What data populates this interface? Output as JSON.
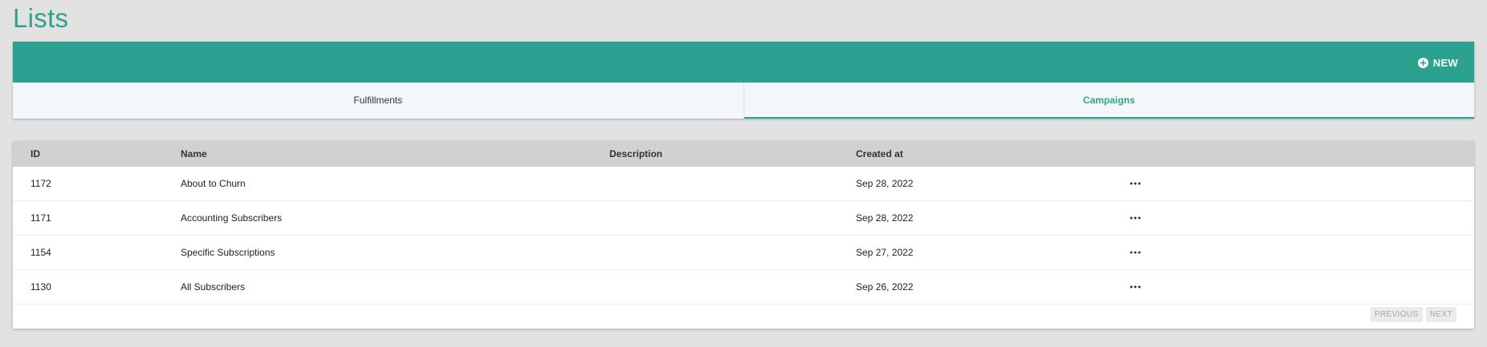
{
  "page": {
    "title": "Lists"
  },
  "header": {
    "new_label": "NEW",
    "tabs": [
      {
        "label": "Fulfillments",
        "active": false
      },
      {
        "label": "Campaigns",
        "active": true
      }
    ]
  },
  "table": {
    "columns": [
      "ID",
      "Name",
      "Description",
      "Created at"
    ],
    "rows": [
      {
        "id": "1172",
        "name": "About to Churn",
        "description": "",
        "created_at": "Sep 28, 2022"
      },
      {
        "id": "1171",
        "name": "Accounting Subscribers",
        "description": "",
        "created_at": "Sep 28, 2022"
      },
      {
        "id": "1154",
        "name": "Specific Subscriptions",
        "description": "",
        "created_at": "Sep 27, 2022"
      },
      {
        "id": "1130",
        "name": "All Subscribers",
        "description": "",
        "created_at": "Sep 26, 2022"
      }
    ],
    "row_action_icon": "more-horizontal-icon"
  },
  "pagination": {
    "previous_label": "PREVIOUS",
    "next_label": "NEXT"
  },
  "colors": {
    "accent": "#2ca190",
    "background": "#e1e2e1",
    "table_header": "#d0d2d1"
  }
}
